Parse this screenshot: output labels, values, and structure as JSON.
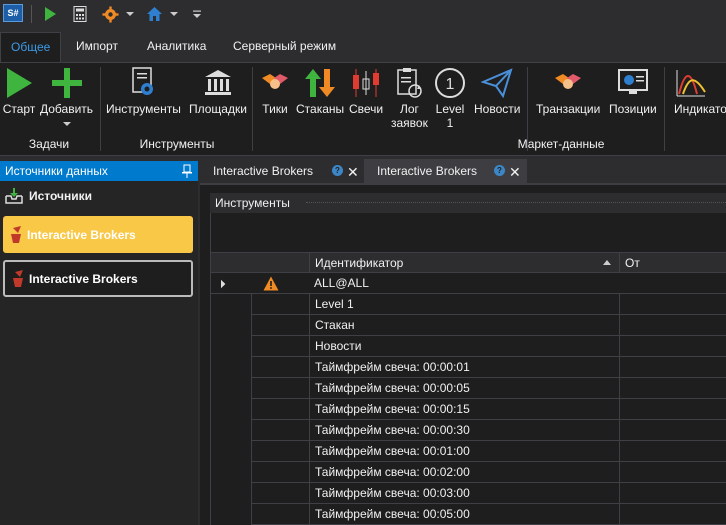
{
  "app": {
    "logo": "S#"
  },
  "quick_access": [
    {
      "name": "play-icon"
    },
    {
      "name": "calculator-icon"
    },
    {
      "name": "gear-icon"
    },
    {
      "name": "home-icon"
    }
  ],
  "ribbon_tabs": [
    {
      "label": "Общее",
      "active": true
    },
    {
      "label": "Импорт"
    },
    {
      "label": "Аналитика"
    },
    {
      "label": "Серверный режим"
    }
  ],
  "ribbon": {
    "buttons": {
      "start": "Старт",
      "add": "Добавить",
      "instruments": "Инструменты",
      "exchanges": "Площадки",
      "ticks": "Тики",
      "depths": "Стаканы",
      "candles": "Свечи",
      "order_log_1": "Лог",
      "order_log_2": "заявок",
      "level1_1": "Level",
      "level1_2": "1",
      "news": "Новости",
      "transactions": "Транзакции",
      "positions": "Позиции",
      "indicators": "Индикато"
    },
    "groups": {
      "tasks": "Задачи",
      "instruments": "Инструменты",
      "market_data": "Маркет-данные"
    },
    "colors": {
      "green": "#3fb53f",
      "orange": "#f08a24",
      "red": "#e03c31",
      "blue": "#2f7fd1"
    }
  },
  "left_panel": {
    "header": "Источники данных",
    "sources_title": "Источники",
    "sources": [
      {
        "label": "Interactive Brokers",
        "selected": true
      },
      {
        "label": "Interactive Brokers",
        "selected": false
      }
    ]
  },
  "doc_tabs": [
    {
      "label": "Interactive Brokers",
      "help": "?",
      "close": "✕"
    },
    {
      "label": "Interactive Brokers",
      "help": "?",
      "close": "✕"
    }
  ],
  "instruments_panel": {
    "header": "Инструменты",
    "columns": {
      "identifier": "Идентификатор",
      "from": "От"
    },
    "group": "ALL@ALL",
    "rows": [
      "Level 1",
      "Стакан",
      "Новости",
      "Таймфрейм свеча: 00:00:01",
      "Таймфрейм свеча: 00:00:05",
      "Таймфрейм свеча: 00:00:15",
      "Таймфрейм свеча: 00:00:30",
      "Таймфрейм свеча: 00:01:00",
      "Таймфрейм свеча: 00:02:00",
      "Таймфрейм свеча: 00:03:00",
      "Таймфрейм свеча: 00:05:00"
    ]
  }
}
